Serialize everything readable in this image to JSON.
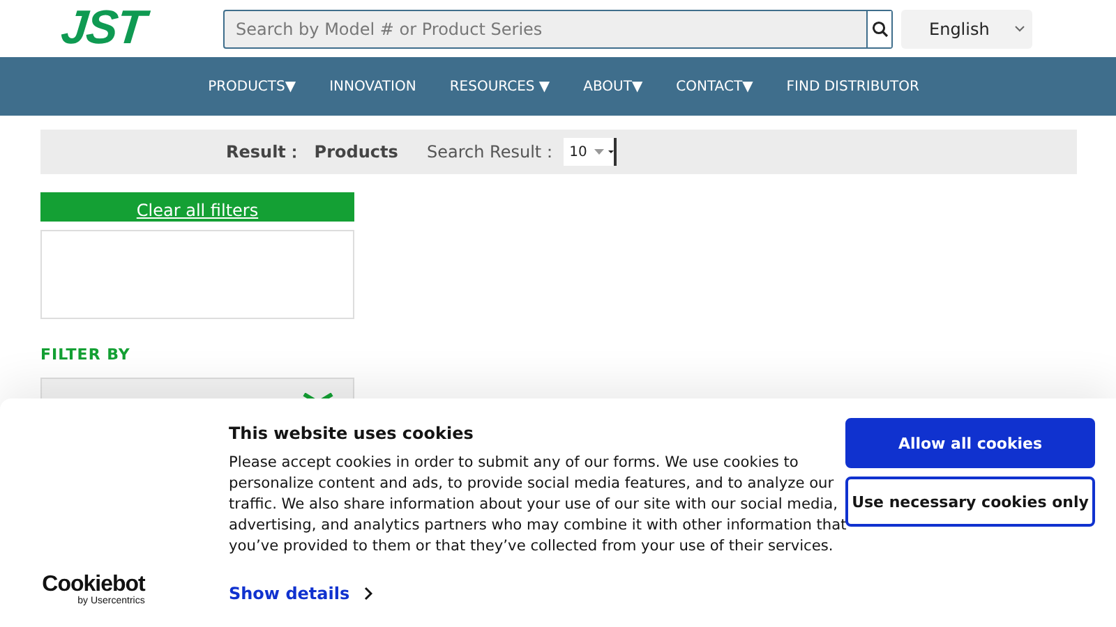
{
  "header": {
    "logo": "JST",
    "search": {
      "placeholder": "Search by Model # or Product Series"
    },
    "language": "English"
  },
  "nav": [
    {
      "label": "PRODUCTS▼"
    },
    {
      "label": "INNOVATION"
    },
    {
      "label": "RESOURCES ▼"
    },
    {
      "label": "ABOUT▼"
    },
    {
      "label": "CONTACT▼"
    },
    {
      "label": "FIND DISTRIBUTOR"
    }
  ],
  "result_bar": {
    "result": "Result：  Products",
    "search_result_label": "Search Result：",
    "per_page": "10"
  },
  "sidebar": {
    "clear_button": "Clear all filters",
    "filter_heading": "FILTER BY"
  },
  "cookie_banner": {
    "brand": "Cookiebot",
    "brand_sub": "by Usercentrics",
    "title": "This website uses cookies",
    "body": "Please accept cookies in order to submit any of our forms. We use cookies to personalize content and ads, to provide social media features, and to analyze our traffic. We also share information about your use of our site with our social media, advertising, and analytics partners who may combine it with other information that you’ve provided to them or that they’ve collected from your use of their services.",
    "details_link": "Show details",
    "buttons": [
      {
        "label": "Allow all cookies",
        "kind": "primary"
      },
      {
        "label": "Use necessary cookies only",
        "kind": "outline"
      }
    ]
  }
}
